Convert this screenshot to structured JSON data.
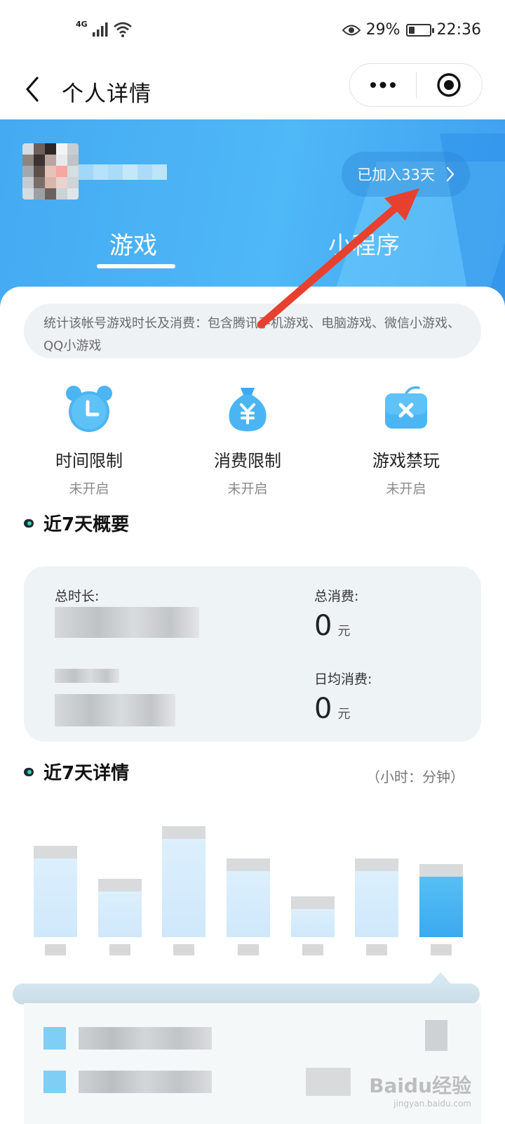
{
  "status_bar": {
    "network": "4G",
    "battery_percent_text": "29%",
    "battery_level": 0.29,
    "time": "22:36"
  },
  "nav": {
    "title": "个人详情"
  },
  "header": {
    "joined_label": "已加入33天",
    "tabs": [
      {
        "label": "游戏",
        "active": true
      },
      {
        "label": "小程序",
        "active": false
      }
    ]
  },
  "notice": "统计该帐号游戏时长及消费：包含腾讯手机游戏、电脑游戏、微信小游戏、QQ小游戏",
  "features": [
    {
      "label": "时间限制",
      "status": "未开启",
      "icon": "alarm-clock-icon"
    },
    {
      "label": "消费限制",
      "status": "未开启",
      "icon": "money-bag-icon"
    },
    {
      "label": "游戏禁玩",
      "status": "未开启",
      "icon": "game-ban-icon"
    }
  ],
  "summary": {
    "title": "近7天概要",
    "total_duration_label": "总时长:",
    "total_spend_label": "总消费:",
    "total_spend_value": "0",
    "daily_spend_label": "日均消费:",
    "daily_spend_value": "0",
    "currency_unit": "元"
  },
  "details": {
    "title": "近7天详情",
    "unit_note": "（小时：分钟）"
  },
  "chart_data": {
    "type": "bar",
    "note": "values are pixelated/obscured in the screenshot; relative bar heights estimated",
    "values": [
      0.62,
      0.36,
      0.78,
      0.52,
      0.22,
      0.52,
      0.48
    ],
    "highlighted_index": 6
  },
  "watermark": {
    "brand": "Baidu经验",
    "url": "jingyan.baidu.com"
  },
  "colors": {
    "accent": "#44aaf2",
    "annotation_arrow": "#e8402f"
  }
}
